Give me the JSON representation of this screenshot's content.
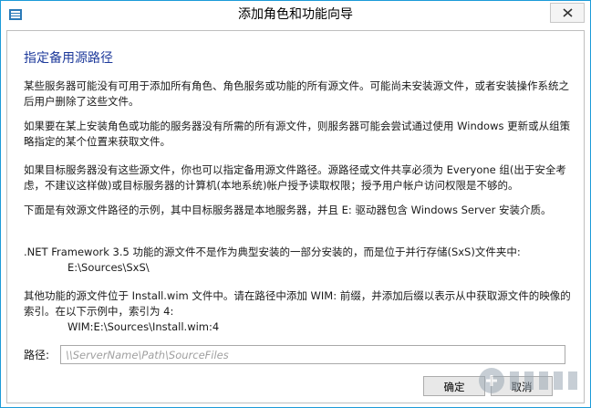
{
  "window": {
    "title": "添加角色和功能向导"
  },
  "content": {
    "heading": "指定备用源路径",
    "paragraphs": [
      "某些服务器可能没有可用于添加所有角色、角色服务或功能的所有源文件。可能尚未安装源文件，或者安装操作系统之后用户删除了这些文件。",
      "如果要在某上安装角色或功能的服务器没有所需的所有源文件，则服务器可能会尝试通过使用 Windows 更新或从组策略指定的某个位置来获取文件。",
      "如果目标服务器没有这些源文件，你也可以指定备用源文件路径。源路径或文件共享必须为 Everyone 组(出于安全考虑，不建议这样做)或目标服务器的计算机(本地系统)帐户授予读取权限；授予用户帐户访问权限是不够的。",
      "下面是有效源文件路径的示例，其中目标服务器是本地服务器，并且 E: 驱动器包含 Windows Server 安装介质。",
      ".NET Framework 3.5 功能的源文件不是作为典型安装的一部分安装的，而是位于并行存储(SxS)文件夹中:",
      "其他功能的源文件位于 Install.wim 文件中。请在路径中添加 WIM: 前缀，并添加后缀以表示从中获取源文件的映像的索引。在以下示例中，索引为 4:"
    ],
    "example_sxs": "E:\\Sources\\SxS\\",
    "example_wim": "WIM:E:\\Sources\\Install.wim:4"
  },
  "path": {
    "label": "路径:",
    "placeholder": "\\\\ServerName\\Path\\SourceFiles",
    "value": ""
  },
  "buttons": {
    "ok": "确定",
    "cancel": "取消"
  },
  "colors": {
    "heading": "#1e3a9b",
    "border_accent": "#1c9bd8"
  },
  "icons": {
    "app": "server-manager-icon",
    "close": "close-icon",
    "watermark": "system-watermark-icon"
  }
}
